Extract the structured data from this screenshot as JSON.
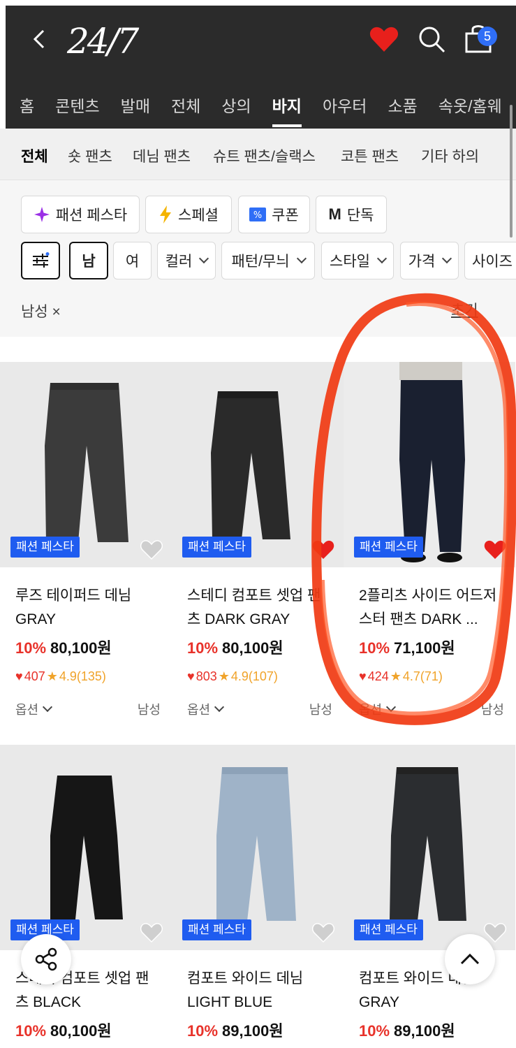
{
  "header": {
    "logo": "24/7",
    "bag_count": "5"
  },
  "main_nav": [
    "홈",
    "콘텐츠",
    "발매",
    "전체",
    "상의",
    "바지",
    "아우터",
    "소품",
    "속옷/홈웨"
  ],
  "sub_nav": [
    "전체",
    "숏 팬츠",
    "데님 팬츠",
    "슈트 팬츠/슬랙스",
    "코튼 팬츠",
    "기타 하의"
  ],
  "promo_filters": [
    {
      "label": "패션 페스타",
      "icon": "sparkle-icon"
    },
    {
      "label": "스페셜",
      "icon": "lightning-icon"
    },
    {
      "label": "쿠폰",
      "icon": "coupon-icon"
    },
    {
      "label": "단독",
      "icon": "m-icon"
    }
  ],
  "filters": {
    "male": "남",
    "female": "여",
    "dropdowns": [
      "컬러",
      "패턴/무늬",
      "스타일",
      "가격",
      "사이즈"
    ]
  },
  "active_tag": "남성 ×",
  "reset": "초기",
  "products": [
    {
      "name": "루즈 테이퍼드 데님 GRAY",
      "discount": "10%",
      "price": "80,100원",
      "likes": "407",
      "rating": "4.9(135)",
      "badge": "패션 페스타",
      "option": "옵션",
      "gender": "남성",
      "liked": false
    },
    {
      "name": "스테디 컴포트 셋업 팬츠 DARK GRAY",
      "discount": "10%",
      "price": "80,100원",
      "likes": "803",
      "rating": "4.9(107)",
      "badge": "패션 페스타",
      "option": "옵션",
      "gender": "남성",
      "liked": true
    },
    {
      "name": "2플리츠 사이드 어드저스터 팬츠 DARK ...",
      "discount": "10%",
      "price": "71,100원",
      "likes": "424",
      "rating": "4.7(71)",
      "badge": "패션 페스타",
      "option": "옵션",
      "gender": "남성",
      "liked": true
    },
    {
      "name": "스테디 컴포트 셋업 팬츠 BLACK",
      "discount": "10%",
      "price": "80,100원",
      "badge": "패션 페스타",
      "liked": false
    },
    {
      "name": "컴포트 와이드 데님 LIGHT BLUE",
      "discount": "10%",
      "price": "89,100원",
      "badge": "패션 페스타",
      "liked": false
    },
    {
      "name": "컴포트 와이드 데님 GRAY",
      "discount": "10%",
      "price": "89,100원",
      "badge": "패션 페스타",
      "liked": false
    }
  ],
  "colors": {
    "header_bg": "#2b2b2b",
    "accent_red": "#e8322a",
    "badge_blue": "#1f5cf0",
    "star": "#f0a32a"
  }
}
